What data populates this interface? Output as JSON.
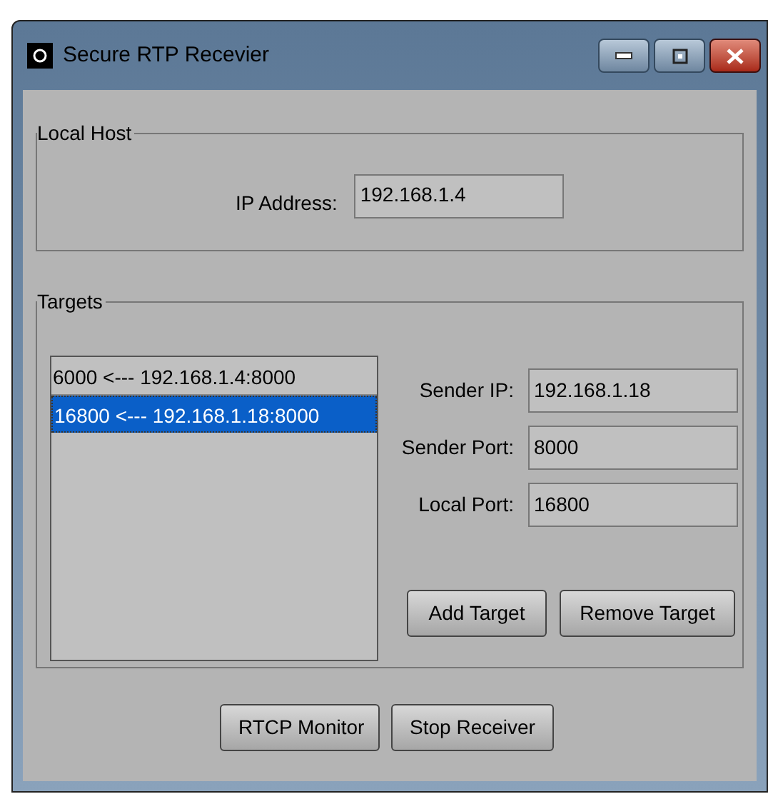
{
  "window": {
    "title": "Secure RTP Recevier"
  },
  "local_host": {
    "legend": "Local Host",
    "ip_label": "IP Address:",
    "ip_value": "192.168.1.4"
  },
  "targets": {
    "legend": "Targets",
    "list": [
      {
        "text": "6000 <--- 192.168.1.4:8000",
        "selected": false
      },
      {
        "text": "16800 <--- 192.168.1.18:8000",
        "selected": true
      }
    ],
    "fields": [
      {
        "label": "Sender IP:",
        "value": "192.168.1.18"
      },
      {
        "label": "Sender Port:",
        "value": "8000"
      },
      {
        "label": "Local Port:",
        "value": "16800"
      }
    ],
    "buttons": [
      "Add Target",
      "Remove Target"
    ]
  },
  "buttons": [
    "RTCP Monitor",
    "Stop Receiver"
  ]
}
